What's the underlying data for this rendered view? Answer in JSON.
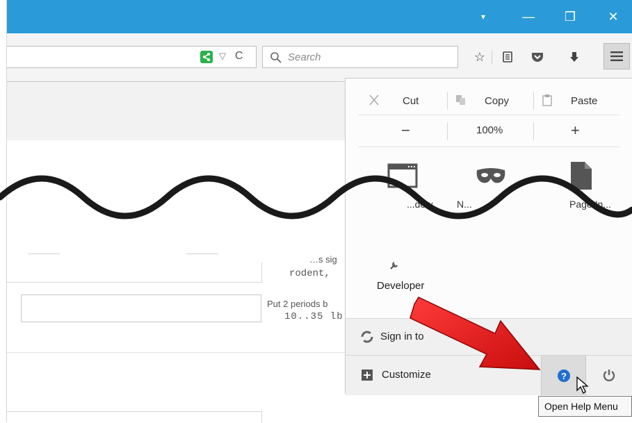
{
  "window": {
    "controls": {
      "dropdown": "▾",
      "minimize": "—",
      "restore": "❐",
      "close": "✕"
    }
  },
  "navbar": {
    "search_placeholder": "Search",
    "reload_glyph": "C",
    "dropmarker_glyph": "▽"
  },
  "page": {
    "snippet_top": "…s sig",
    "snippet_mono1": "rodent,",
    "snippet_help": "Put 2 periods b",
    "snippet_mono2": "10..35 lb"
  },
  "menu": {
    "edit": {
      "cut": "Cut",
      "copy": "Copy",
      "paste": "Paste"
    },
    "zoom": {
      "minus": "−",
      "level": "100%",
      "plus": "+"
    },
    "items": {
      "new_window_partial": "...dow",
      "private_partial": "N...",
      "save_page_partial": "Page In..."
    },
    "developer": "Developer",
    "sign_in": "Sign in to",
    "customize": "Customize"
  },
  "tooltip": "Open Help Menu",
  "colors": {
    "titlebar": "#2b9ad8",
    "help_blue": "#1f6fcf",
    "arrow_red": "#e31b1b",
    "share_green": "#2bb24c"
  }
}
